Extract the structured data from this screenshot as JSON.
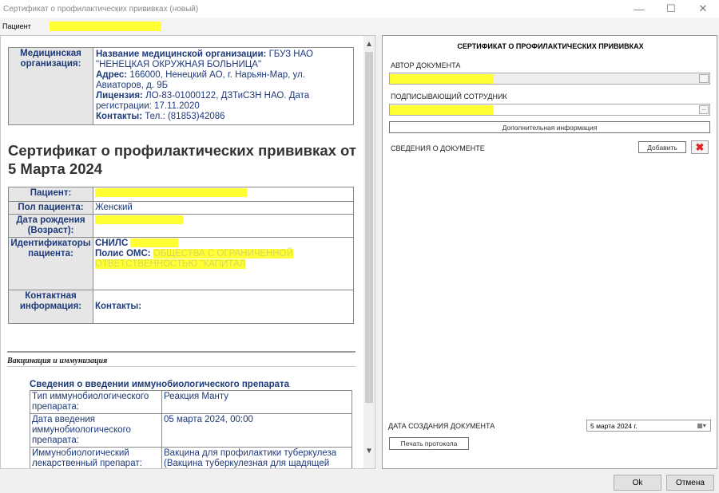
{
  "window": {
    "title": "Сертификат о профилактических прививках (новый)",
    "minimize": "—",
    "maximize": "☐",
    "close": "✕"
  },
  "patient_bar": {
    "label": "Пациент",
    "value": ""
  },
  "doc": {
    "org_label": "Медицинская организация:",
    "org_name_label": "Название медицинской организации:",
    "org_name_value": "ГБУЗ НАО \"НЕНЕЦКАЯ ОКРУЖНАЯ БОЛЬНИЦА\"",
    "address_label": "Адрес:",
    "address_value": "166000, Ненецкий АО, г. Нарьян-Мар, ул. Авиаторов, д. 9Б",
    "license_label": "Лицензия:",
    "license_value": "ЛО-83-01000122, ДЗТиСЗН НАО. Дата регистрации: 17.11.2020",
    "contacts_label": "Контакты:",
    "contacts_value": "Тел.: (81853)42086",
    "title": "Сертификат о профилактических прививках от 5 Марта 2024",
    "patient_label": "Пациент:",
    "patient_value": "",
    "sex_label": "Пол пациента:",
    "sex_value": "Женский",
    "dob_label": "Дата рождения (Возраст):",
    "dob_value": "",
    "ids_label": "Идентификаторы пациента:",
    "snils_label": "СНИЛС",
    "oms_label": "Полис ОМС:",
    "oms_value": "ОБЩЕСТВА С ОГРАНИЧЕННОЙ ОТВЕТСТВЕННОСТЬЮ \"КАПИТАЛ",
    "contact_info_label": "Контактная информация:",
    "contact_contacts_label": "Контакты:",
    "section_title": "Вакцинация и иммунизация",
    "subhead": "Сведения о введении иммунобиологического препарата",
    "vac_rows": [
      {
        "k": "Тип иммунобиологического препарата:",
        "v": "Реакция Манту"
      },
      {
        "k": "Дата введения иммунобиологического препарата:",
        "v": "05 марта 2024, 00:00"
      },
      {
        "k": "Иммунобиологический лекарственный препарат:",
        "v": "Вакцина для профилактики туберкулеза (Вакцина туберкулезная для щадящей"
      }
    ]
  },
  "right": {
    "title": "СЕРТИФИКАТ О ПРОФИЛАКТИЧЕСКИХ ПРИВИВКАХ",
    "author_label": "АВТОР ДОКУМЕНТА",
    "signer_label": "ПОДПИСЫВАЮЩИЙ СОТРУДНИК",
    "field_btn": "...",
    "extra_info_btn": "Дополнительная информация",
    "doc_info_label": "СВЕДЕНИЯ О ДОКУМЕНТЕ",
    "add_btn": "Добавить",
    "delete_icon": "✖",
    "created_label": "ДАТА СОЗДАНИЯ ДОКУМЕНТА",
    "created_value": "5  марта  2024 г.",
    "calendar_icon": "▦▾",
    "print_btn": "Печать протокола"
  },
  "scroll": {
    "up": "▲",
    "down": "▼"
  },
  "footer": {
    "ok": "Ok",
    "cancel": "Отмена"
  }
}
